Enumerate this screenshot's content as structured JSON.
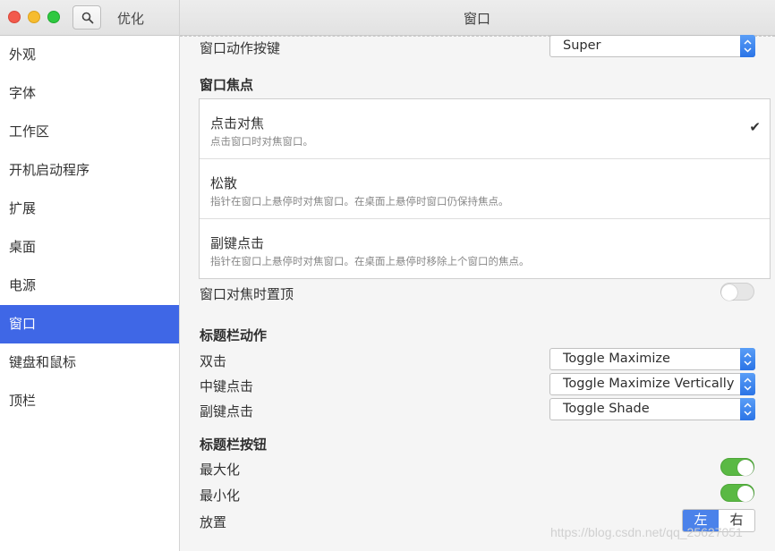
{
  "window": {
    "app_title": "优化",
    "page_title": "窗口"
  },
  "sidebar": {
    "items": [
      {
        "label": "外观",
        "active": false
      },
      {
        "label": "字体",
        "active": false
      },
      {
        "label": "工作区",
        "active": false
      },
      {
        "label": "开机启动程序",
        "active": false
      },
      {
        "label": "扩展",
        "active": false
      },
      {
        "label": "桌面",
        "active": false
      },
      {
        "label": "电源",
        "active": false
      },
      {
        "label": "窗口",
        "active": true
      },
      {
        "label": "键盘和鼠标",
        "active": false
      },
      {
        "label": "顶栏",
        "active": false
      }
    ]
  },
  "main": {
    "action_key": {
      "label": "窗口动作按键",
      "value": "Super"
    },
    "focus": {
      "heading": "窗口焦点",
      "options": [
        {
          "title": "点击对焦",
          "desc": "点击窗口时对焦窗口。",
          "selected": true
        },
        {
          "title": "松散",
          "desc": "指针在窗口上悬停时对焦窗口。在桌面上悬停时窗口仍保持焦点。",
          "selected": false
        },
        {
          "title": "副键点击",
          "desc": "指针在窗口上悬停时对焦窗口。在桌面上悬停时移除上个窗口的焦点。",
          "selected": false
        }
      ],
      "raise_label": "窗口对焦时置顶",
      "raise_on": false
    },
    "titlebar_actions": {
      "heading": "标题栏动作",
      "double_click": {
        "label": "双击",
        "value": "Toggle Maximize"
      },
      "middle_click": {
        "label": "中键点击",
        "value": "Toggle Maximize Vertically"
      },
      "secondary_click": {
        "label": "副键点击",
        "value": "Toggle Shade"
      }
    },
    "titlebar_buttons": {
      "heading": "标题栏按钮",
      "maximize": {
        "label": "最大化",
        "on": true
      },
      "minimize": {
        "label": "最小化",
        "on": true
      },
      "placement": {
        "label": "放置",
        "left": "左",
        "right": "右",
        "selected": "左"
      }
    }
  },
  "watermark": "https://blog.csdn.net/qq_25627051",
  "colors": {
    "accent": "#3f67e6",
    "switch_on": "#5ab944",
    "combo_arrow": "#2b74e6"
  }
}
